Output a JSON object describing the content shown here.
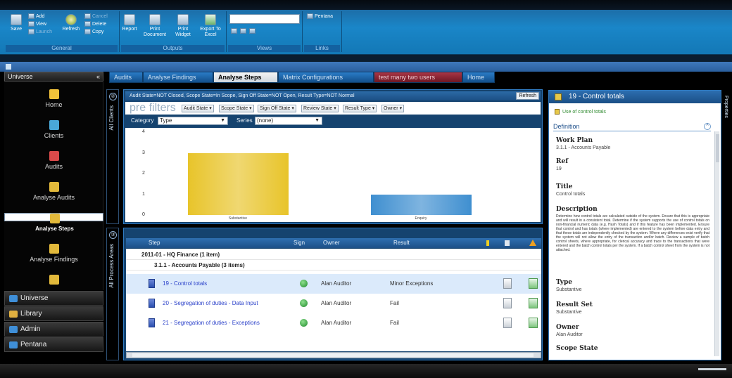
{
  "ribbon": {
    "general": {
      "label": "General",
      "save": "Save",
      "add": "Add",
      "view": "View",
      "launch": "Launch",
      "refresh": "Refresh",
      "cancel": "Cancel",
      "delete": "Delete",
      "copy": "Copy"
    },
    "outputs": {
      "label": "Outputs",
      "report": "Report",
      "print_document": "Print Document",
      "print_widget": "Print Widget",
      "export_excel": "Export To Excel"
    },
    "views": {
      "label": "Views"
    },
    "links": {
      "label": "Links",
      "pentana": "Pentana"
    }
  },
  "nav": {
    "header": "Universe",
    "collapse": "«",
    "items": [
      {
        "label": "Home",
        "icon": "home-icon",
        "color": "#f0c23a"
      },
      {
        "label": "Clients",
        "icon": "clients-icon",
        "color": "#4aa8d8"
      },
      {
        "label": "Audits",
        "icon": "calendar-icon",
        "color": "#d94a4a"
      },
      {
        "label": "Analyse Audits",
        "icon": "analyse-icon",
        "color": "#e2b93b"
      },
      {
        "label": "Analyse Steps",
        "icon": "analyse-icon",
        "color": "#e2b93b"
      },
      {
        "label": "Analyse Findings",
        "icon": "analyse-icon",
        "color": "#e2b93b"
      }
    ],
    "sections": [
      {
        "label": "Universe",
        "color": "#3f8fd8"
      },
      {
        "label": "Library",
        "color": "#e0b040"
      },
      {
        "label": "Admin",
        "color": "#3f8fd8"
      },
      {
        "label": "Pentana",
        "color": "#3f8fd8"
      }
    ]
  },
  "tabs": [
    {
      "label": "Audits"
    },
    {
      "label": "Analyse Findings"
    },
    {
      "label": "Analyse Steps"
    },
    {
      "label": "Matrix Configurations"
    },
    {
      "label": "test many two users"
    },
    {
      "label": "Home"
    }
  ],
  "side_panels": {
    "clients_number": "②",
    "clients": "All Clients",
    "process_number": "③",
    "process": "All Process Areas"
  },
  "filter": {
    "text": "Audit State=NOT Closed, Scope State=In Scope, Sign Off State=NOT Open, Result Type=NOT Normal",
    "refresh": "Refresh",
    "prefilters_label": "pre filters",
    "dropdowns": [
      "Audit State",
      "Scope State",
      "Sign Off State",
      "Review State",
      "Result Type",
      "Owner"
    ]
  },
  "chart_controls": {
    "category_label": "Category",
    "category_value": "Type",
    "series_label": "Series",
    "series_value": "(none)"
  },
  "chart_data": {
    "type": "bar",
    "categories": [
      "Substantive",
      "Enquiry"
    ],
    "values": [
      3,
      1
    ],
    "ylim": [
      0,
      4
    ],
    "yticks": [
      "0",
      "1",
      "2",
      "3",
      "4"
    ],
    "colors": [
      "#e8c42a",
      "#3f8fd0"
    ]
  },
  "grid": {
    "columns": {
      "step": "Step",
      "sign": "Sign",
      "owner": "Owner",
      "result": "Result"
    },
    "group1": "2011-01 - HQ Finance  (1 item)",
    "group2": "3.1.1 - Accounts Payable (3 items)",
    "rows": [
      {
        "step": "19 - Control totals",
        "owner": "Alan Auditor",
        "result": "Minor Exceptions"
      },
      {
        "step": "20 - Segregation of duties - Data Input",
        "owner": "Alan Auditor",
        "result": "Fail"
      },
      {
        "step": "21 - Segregation of duties - Exceptions",
        "owner": "Alan Auditor",
        "result": "Fail"
      }
    ]
  },
  "detail": {
    "title": "19 - Control totals",
    "subtitle": "Use of control totals",
    "definition": "Definition",
    "work_plan_label": "Work Plan",
    "work_plan_value": "3.1.1 - Accounts Payable",
    "ref_label": "Ref",
    "ref_value": "19",
    "title_label": "Title",
    "title_value": "Control totals",
    "description_label": "Description",
    "description_value": "Determine how control totals are calculated outside of the system. Ensure that this is appropriate and will result in a consistent total. Determine if the system supports the use of control totals on non-financial numeric data (e.g. Hash Totals) and if this feature has been implemented. Ensure that control and has totals (where implemented) are entered to the system before data entry and that these totals are independently checked by the system. Where any differences exist verify that the system will not allow the entry of the transaction and/or batch. Review a sample of batch control sheets, where appropriate, for clerical accuracy and trace to the transactions that were entered and the batch control totals per the system. If a batch control sheet from the system is not attached.",
    "type_label": "Type",
    "type_value": "Substantive",
    "result_set_label": "Result Set",
    "result_set_value": "Substantive",
    "owner_label": "Owner",
    "owner_value": "Alan Auditor",
    "scope_state_label": "Scope State"
  },
  "properties_label": "Properties"
}
